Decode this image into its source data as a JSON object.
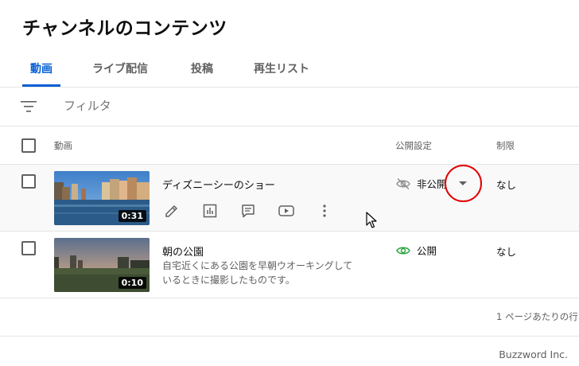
{
  "page_title": "チャンネルのコンテンツ",
  "tabs": [
    {
      "label": "動画",
      "active": true
    },
    {
      "label": "ライブ配信",
      "active": false
    },
    {
      "label": "投稿",
      "active": false
    },
    {
      "label": "再生リスト",
      "active": false
    }
  ],
  "filter": {
    "placeholder": "フィルタ",
    "icon": "filter-icon"
  },
  "table": {
    "headers": {
      "video": "動画",
      "visibility": "公開設定",
      "restrictions": "制限"
    },
    "rows": [
      {
        "title": "ディズニーシーのショー",
        "description": "",
        "duration": "0:31",
        "visibility": "非公開",
        "visibility_icon": "eye-off-icon",
        "restrictions": "なし",
        "actions": [
          "edit-icon",
          "analytics-icon",
          "comments-icon",
          "youtube-icon",
          "more-vert-icon"
        ]
      },
      {
        "title": "朝の公園",
        "description": "自宅近くにある公園を早朝ウオーキングしているときに撮影したものです。",
        "duration": "0:10",
        "visibility": "公開",
        "visibility_icon": "eye-icon",
        "restrictions": "なし"
      }
    ]
  },
  "pagination": {
    "rows_per_page_label": "1 ページあたりの行"
  },
  "credit": "Buzzword Inc.",
  "colors": {
    "accent": "#065fd4",
    "public_green": "#2ba640",
    "annotation_red": "#e00000"
  }
}
